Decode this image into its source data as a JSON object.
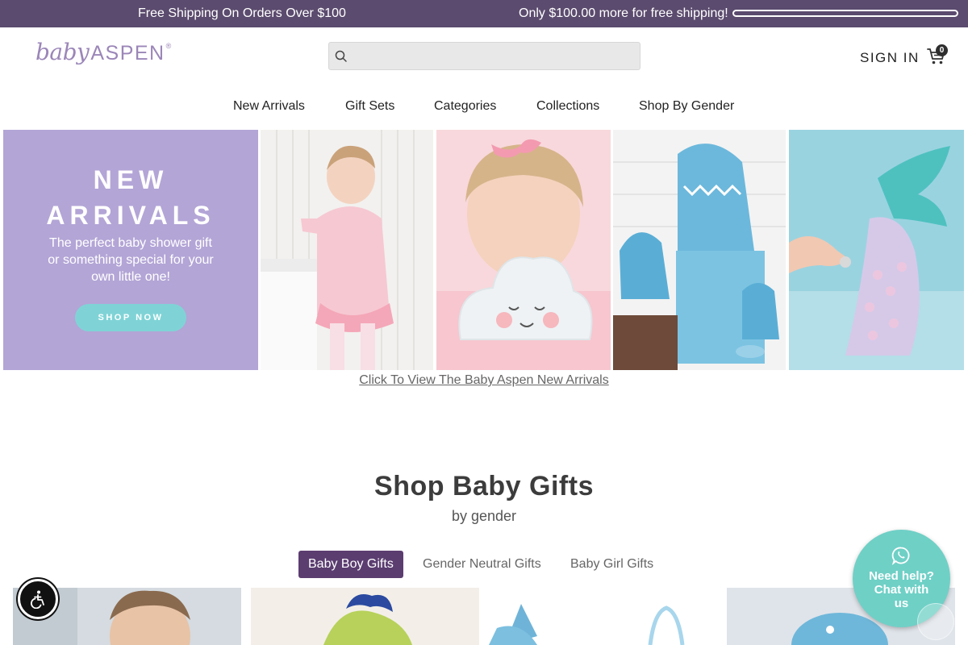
{
  "topbar": {
    "promo": "Free Shipping On Orders Over $100",
    "shipping_status": "Only $100.00 more for free shipping!",
    "shipping_progress": 0
  },
  "header": {
    "logo_part1": "baby",
    "logo_part2": "ASPEN",
    "logo_reg": "®",
    "search_placeholder": "",
    "signin": "SIGN IN",
    "cart_count": "0"
  },
  "nav": {
    "items": [
      "New Arrivals",
      "Gift Sets",
      "Categories",
      "Collections",
      "Shop By Gender"
    ]
  },
  "banner": {
    "heading_line1": "NEW",
    "heading_line2": "ARRIVALS",
    "subtext_line1": "The perfect baby shower gift",
    "subtext_line2": "or something special for your",
    "subtext_line3": "own little one!",
    "cta": "SHOP NOW",
    "link_text": "Click To View The Baby Aspen New Arrivals"
  },
  "section": {
    "title": "Shop Baby Gifts",
    "subtitle": "by gender",
    "tabs": [
      {
        "label": "Baby Boy Gifts",
        "active": true
      },
      {
        "label": "Gender Neutral Gifts",
        "active": false
      },
      {
        "label": "Baby Girl Gifts",
        "active": false
      }
    ]
  },
  "chat": {
    "label_line1": "Need help?",
    "label_line2": "Chat with",
    "label_line3": "us"
  },
  "colors": {
    "topbar": "#5b4b6e",
    "logo": "#9b86b8",
    "banner_panel": "#b3a5d6",
    "cta": "#7fd3d6",
    "active_tab": "#5b3d70",
    "chat": "#6fd0c6"
  }
}
